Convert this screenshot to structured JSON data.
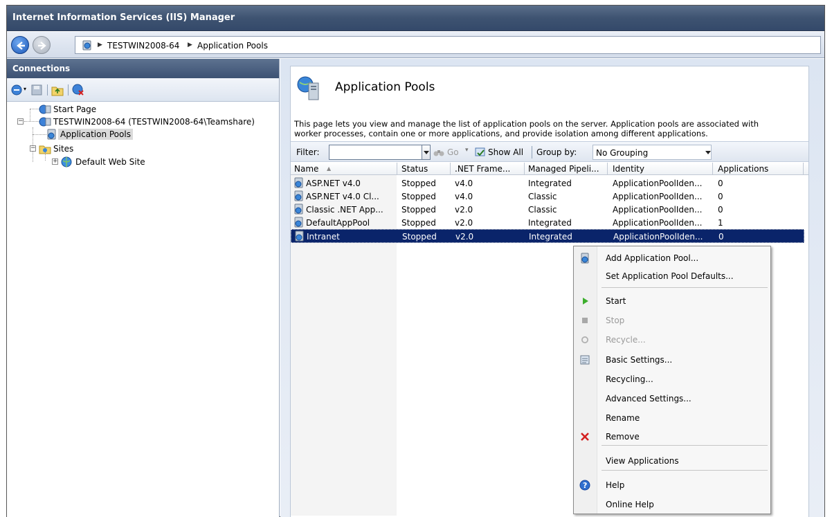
{
  "window": {
    "title": "Internet Information Services (IIS) Manager"
  },
  "address": {
    "crumbs": [
      "TESTWIN2008-64",
      "Application Pools"
    ]
  },
  "connections": {
    "header": "Connections",
    "tree": [
      {
        "label": "Start Page"
      },
      {
        "label": "TESTWIN2008-64 (TESTWIN2008-64\\Teamshare)"
      },
      {
        "label": "Application Pools",
        "selected": true
      },
      {
        "label": "Sites"
      },
      {
        "label": "Default Web Site"
      }
    ]
  },
  "page": {
    "title": "Application Pools",
    "description_line1": "This page lets you view and manage the list of application pools on the server. Application pools are associated with",
    "description_line2": "worker processes, contain one or more applications, and provide isolation among different applications."
  },
  "filterbar": {
    "filter_label": "Filter:",
    "filter_value": "",
    "go_label": "Go",
    "show_all_label": "Show All",
    "group_by_label": "Group by:",
    "group_by_value": "No Grouping"
  },
  "grid": {
    "columns": [
      "Name",
      "Status",
      ".NET Frame...",
      "Managed Pipeli...",
      "Identity",
      "Applications"
    ],
    "sort_indicator": "▲",
    "rows": [
      [
        "ASP.NET v4.0",
        "Stopped",
        "v4.0",
        "Integrated",
        "ApplicationPoolIden...",
        "0"
      ],
      [
        "ASP.NET v4.0 Cl...",
        "Stopped",
        "v4.0",
        "Classic",
        "ApplicationPoolIden...",
        "0"
      ],
      [
        "Classic .NET App...",
        "Stopped",
        "v2.0",
        "Classic",
        "ApplicationPoolIden...",
        "0"
      ],
      [
        "DefaultAppPool",
        "Stopped",
        "v2.0",
        "Integrated",
        "ApplicationPoolIden...",
        "1"
      ],
      [
        "Intranet",
        "Stopped",
        "v2.0",
        "Integrated",
        "ApplicationPoolIden...",
        "0"
      ]
    ],
    "selected_row": 4
  },
  "context_menu": {
    "items": [
      {
        "label": "Add Application Pool...",
        "icon": "add-pool-icon"
      },
      {
        "label": "Set Application Pool Defaults..."
      },
      {
        "label": "Start",
        "icon": "start-icon"
      },
      {
        "label": "Stop",
        "icon": "stop-icon",
        "disabled": true
      },
      {
        "label": "Recycle...",
        "icon": "recycle-icon",
        "disabled": true
      },
      {
        "label": "Basic Settings...",
        "icon": "basic-settings-icon"
      },
      {
        "label": "Recycling..."
      },
      {
        "label": "Advanced Settings..."
      },
      {
        "label": "Rename"
      },
      {
        "label": "Remove",
        "icon": "remove-icon"
      },
      {
        "label": "View Applications"
      },
      {
        "label": "Help",
        "icon": "help-icon"
      },
      {
        "label": "Online Help"
      }
    ]
  },
  "colors": {
    "selection": "#0a246a",
    "titlebar": "#3e5371",
    "start_green": "#3cae2c",
    "remove_red": "#d42020"
  }
}
